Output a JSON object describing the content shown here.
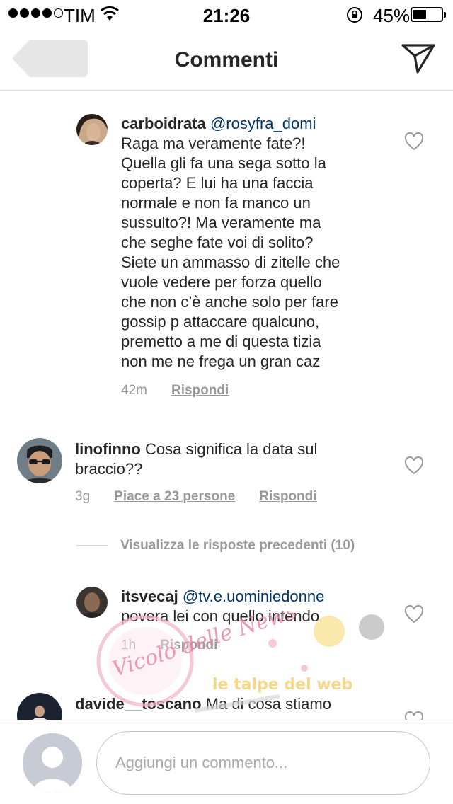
{
  "status_bar": {
    "carrier": "TIM",
    "time": "21:26",
    "battery_percent": "45%",
    "battery_level": 0.45,
    "signal_bars": 4
  },
  "header": {
    "title": "Commenti",
    "back_icon": "chevron-left-icon",
    "action_icon": "direct-send-icon"
  },
  "comments": [
    {
      "username": "carboidrata",
      "mention": "@rosyfra_domi",
      "lines": [
        "Raga ma veramente fate?!",
        "Quella gli fa una sega sotto la",
        "coperta? E lui ha una faccia",
        "normale e non fa manco un",
        "sussulto?! Ma veramente ma",
        "che seghe fate voi di solito?",
        "Siete un ammasso di zitelle che",
        "vuole vedere per forza quello",
        "che non c’è anche solo per fare",
        "gossip p attaccare qualcuno,",
        "premetto a me di questa tizia",
        "non me ne frega un gran caz"
      ],
      "time": "42m",
      "reply_label": "Rispondi"
    },
    {
      "username": "linofinno",
      "first_line": "Cosa significa la data sul",
      "second_line": "braccio??",
      "time": "3g",
      "likes_label": "Piace a 23 persone",
      "reply_label": "Rispondi"
    },
    {
      "username": "itsvecaj",
      "mention": "@tv.e.uominiedonne",
      "text": "povera lei con quello intendo",
      "time": "1h",
      "reply_label": "Rispondi"
    },
    {
      "username": "davide__toscano",
      "text": "Ma di cosa stiamo"
    }
  ],
  "view_previous_replies": "Visualizza le risposte precedenti (10)",
  "watermark": {
    "left_text": "Vicolo delle News",
    "right_text": "le talpe del web"
  },
  "composer": {
    "placeholder": "Aggiungi un commento..."
  },
  "colors": {
    "text": "#262626",
    "mention": "#003569",
    "meta": "#999999",
    "divider": "#dbdbdb"
  }
}
